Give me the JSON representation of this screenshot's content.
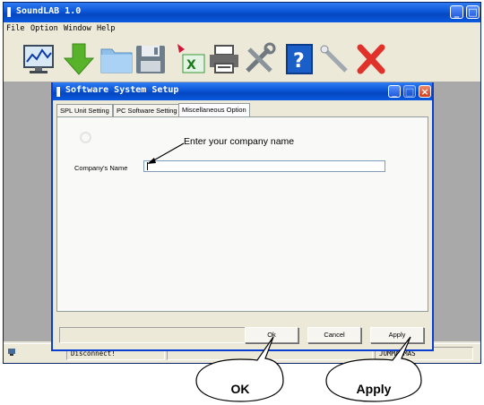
{
  "main_window": {
    "title": "SoundLAB 1.0",
    "menu": [
      "File",
      "Option",
      "Window",
      "Help"
    ],
    "toolbar_icons": [
      "monitor-chart-icon",
      "download-arrow-icon",
      "folder-icon",
      "save-icon",
      "export-excel-icon",
      "print-icon",
      "tools-icon",
      "help-icon",
      "magic-wand-icon",
      "exit-icon"
    ],
    "status": {
      "connection": "Disconnect!",
      "right": "JUMMA MAS"
    }
  },
  "dialog": {
    "title": "Software System Setup",
    "tabs": [
      "SPL Unit Setting",
      "PC Software Setting",
      "Miscellaneous Option"
    ],
    "active_tab": "Miscellaneous Option",
    "company_label": "Company's Name",
    "company_value": "",
    "buttons": {
      "ok": "Ok",
      "cancel": "Cancel",
      "apply": "Apply"
    }
  },
  "annotations": {
    "company_hint": "Enter your company name",
    "ok_bubble": "OK",
    "apply_bubble": "Apply"
  },
  "colors": {
    "title_blue": "#0a56d8",
    "client_gray": "#a9a9a9",
    "close_red": "#d33b1a"
  }
}
